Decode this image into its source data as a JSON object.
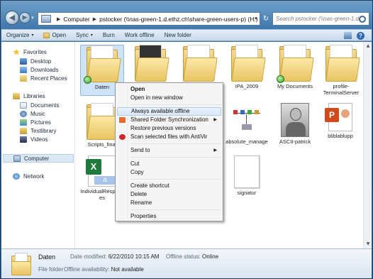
{
  "address": {
    "crumbs": [
      "Computer",
      "pstocker (\\\\nas-green-1.d.ethz.ch\\share-green-users-p) (H:)"
    ],
    "search_placeholder": "Search pstocker (\\\\nas-green-1.d.ethz..."
  },
  "toolbar": {
    "organize": "Organize",
    "open": "Open",
    "sync": "Sync",
    "burn": "Burn",
    "work_offline": "Work offline",
    "new_folder": "New folder"
  },
  "nav": {
    "favorites": "Favorites",
    "desktop": "Desktop",
    "downloads": "Downloads",
    "recent_places": "Recent Places",
    "libraries": "Libraries",
    "documents": "Documents",
    "music": "Music",
    "pictures": "Pictures",
    "testlibrary": "Testlibrary",
    "videos": "Videos",
    "computer": "Computer",
    "network": "Network"
  },
  "files": {
    "daten": "Daten",
    "ipa": "IPA_2009",
    "mydocs": "My Documents",
    "profile": "profile-TerminalServer",
    "scripts": "Scripts_final",
    "absolute": "absolute_manage",
    "ascii": "ASCII-patrick",
    "bliblab": "bliblablupp",
    "individual": "IndividualResponses",
    "signatur": "signatur"
  },
  "menu": {
    "open": "Open",
    "open_new": "Open in new window",
    "always_offline": "Always available offline",
    "shared_sync": "Shared Folder Synchronization",
    "restore": "Restore previous versions",
    "scan": "Scan selected files with AntiVir",
    "send_to": "Send to",
    "cut": "Cut",
    "copy": "Copy",
    "create_shortcut": "Create shortcut",
    "delete": "Delete",
    "rename": "Rename",
    "properties": "Properties"
  },
  "details": {
    "name": "Daten",
    "type": "File folder",
    "date_label": "Date modified:",
    "date_value": "6/22/2010 10:15 AM",
    "offline_status_label": "Offline status:",
    "offline_status_value": "Online",
    "availability_label": "Offline availability:",
    "availability_value": "Not available"
  },
  "colors": {
    "accent": "#3f78ad",
    "selection": "#cde3f8",
    "menu_highlight": "#d9e8f8"
  }
}
